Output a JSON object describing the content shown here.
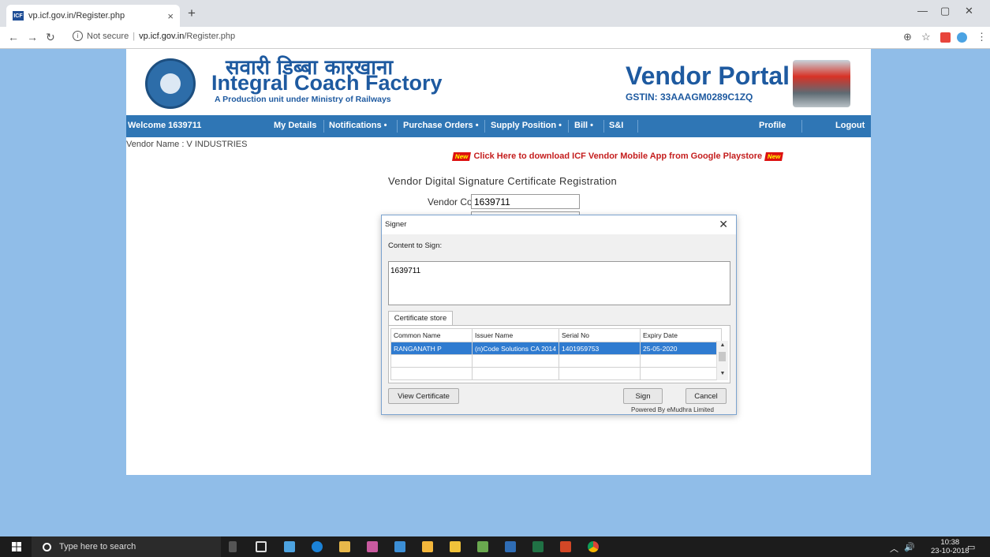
{
  "browser": {
    "tab_title": "vp.icf.gov.in/Register.php",
    "favicon_text": "ICF",
    "security": "Not secure",
    "url_host": "vp.icf.gov.in",
    "url_path": "/Register.php"
  },
  "header": {
    "hindi_title": "सवारी डिब्बा कारखाना",
    "title": "Integral Coach Factory",
    "subtitle": "A Production unit under Ministry of Railways",
    "portal_title": "Vendor Portal",
    "gstin": "GSTIN: 33AAAGM0289C1ZQ"
  },
  "menu": {
    "welcome": "Welcome 1639711",
    "my_details": "My Details",
    "notifications": "Notifications •",
    "purchase_orders": "Purchase Orders •",
    "supply_position": "Supply Position •",
    "bill": "Bill •",
    "si": "S&I",
    "profile": "Profile",
    "logout": "Logout"
  },
  "page": {
    "vendor_name": "Vendor Name : V INDUSTRIES",
    "new_badge": "New",
    "promo_text": "Click Here to download ICF Vendor Mobile App from Google Playstore",
    "reg_title": "Vendor Digital Signature Certificate Registration",
    "vendor_code_label": "Vendor Code",
    "vendor_code_value": "1639711"
  },
  "signer": {
    "title": "Signer",
    "content_label": "Content to Sign:",
    "content_value": "1639711",
    "store_tab": "Certificate store",
    "columns": [
      "Common Name",
      "Issuer Name",
      "Serial No",
      "Expiry Date"
    ],
    "rows": [
      [
        "RANGANATH P",
        "(n)Code Solutions CA 2014",
        "1401959753",
        "25-05-2020"
      ]
    ],
    "view_btn": "View Certificate",
    "sign_btn": "Sign",
    "cancel_btn": "Cancel",
    "powered": "Powered By eMudhra Limited"
  },
  "taskbar": {
    "search_placeholder": "Type here to search",
    "time": "10:38",
    "date": "23-10-2018"
  }
}
